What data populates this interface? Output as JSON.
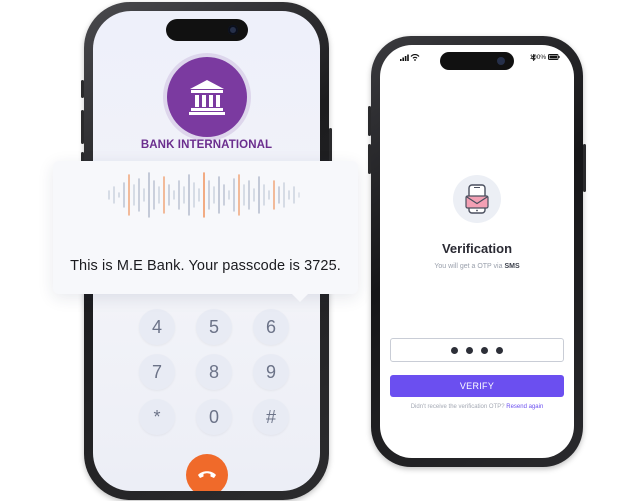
{
  "call_screen": {
    "bank_name": "BANK INTERNATIONAL",
    "voice_message": "This is M.E Bank. Your passcode is 3725.",
    "keypad": [
      "4",
      "5",
      "6",
      "7",
      "8",
      "9",
      "*",
      "0",
      "#"
    ]
  },
  "verify_screen": {
    "battery": "100%",
    "title": "Verification",
    "subtitle_prefix": "You will get a OTP via",
    "subtitle_channel": "SMS",
    "button_label": "VERIFY",
    "resend_prefix": "Didn't receive the verification OTP?",
    "resend_link": "Resend again"
  },
  "colors": {
    "brand_purple": "#7b3aa0",
    "accent_violet": "#6b4ff0",
    "end_call_orange": "#f06a2a"
  },
  "icons": {
    "bank": "bank-building-icon",
    "end_call": "phone-hangup-icon",
    "otp": "mobile-mail-icon"
  }
}
